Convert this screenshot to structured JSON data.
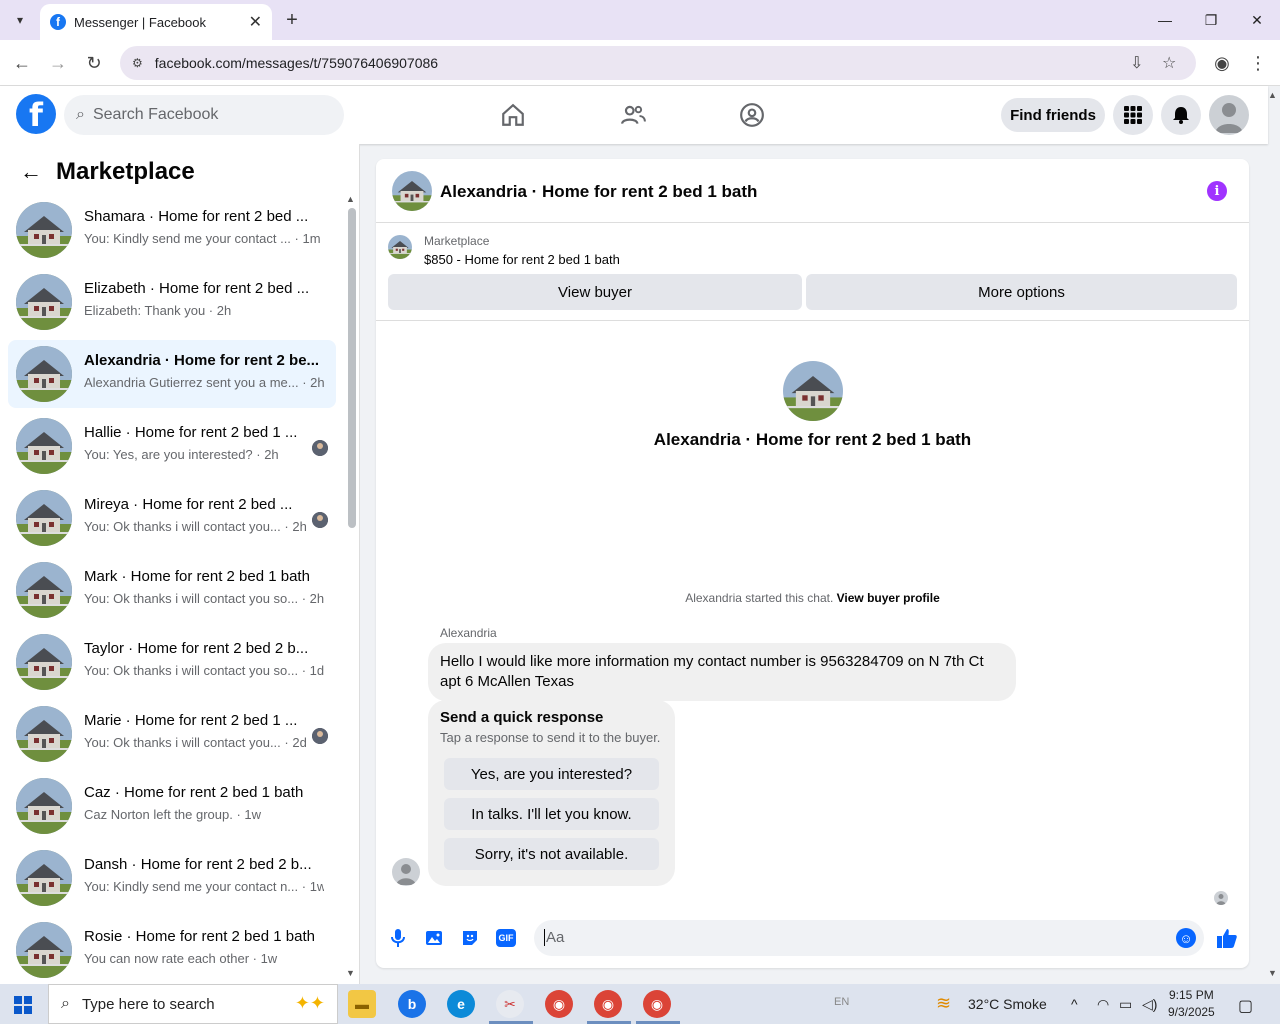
{
  "browser": {
    "tab_title": "Messenger | Facebook",
    "url": "facebook.com/messages/t/759076406907086"
  },
  "header": {
    "search_placeholder": "Search Facebook",
    "find_friends": "Find friends"
  },
  "sidebar": {
    "title": "Marketplace",
    "conversations": [
      {
        "name": "Shamara · Home for rent 2 bed ...",
        "snippet": "You: Kindly send me your contact ... · 1m",
        "mini": false
      },
      {
        "name": "Elizabeth · Home for rent 2 bed ...",
        "snippet": "Elizabeth: Thank you · 2h",
        "mini": false
      },
      {
        "name": "Alexandria · Home for rent 2 be...",
        "snippet": "Alexandria Gutierrez sent you a me... · 2h",
        "mini": false
      },
      {
        "name": "Hallie · Home for rent 2 bed 1 ...",
        "snippet": "You: Yes, are you interested? · 2h",
        "mini": true
      },
      {
        "name": "Mireya · Home for rent 2 bed ...",
        "snippet": "You: Ok thanks i will contact you... · 2h",
        "mini": true
      },
      {
        "name": "Mark · Home for rent 2 bed 1 bath",
        "snippet": "You: Ok thanks i will contact you so... · 2h",
        "mini": false
      },
      {
        "name": "Taylor · Home for rent 2 bed 2 b...",
        "snippet": "You: Ok thanks i will contact you so... · 1d",
        "mini": false
      },
      {
        "name": "Marie · Home for rent 2 bed 1 ...",
        "snippet": "You: Ok thanks i will contact you... · 2d",
        "mini": true
      },
      {
        "name": "Caz · Home for rent 2 bed 1 bath",
        "snippet": "Caz Norton left the group. · 1w",
        "mini": false
      },
      {
        "name": "Dansh · Home for rent 2 bed 2 b...",
        "snippet": "You: Kindly send me your contact n... · 1w",
        "mini": false
      },
      {
        "name": "Rosie · Home for rent 2 bed 1 bath",
        "snippet": "You can now rate each other · 1w",
        "mini": false
      }
    ]
  },
  "chat": {
    "title": "Alexandria · Home for rent 2 bed 1 bath",
    "marketplace_label": "Marketplace",
    "listing": "$850 - Home for rent 2 bed 1 bath",
    "view_buyer": "View buyer",
    "more_options": "More options",
    "center_name": "Alexandria · Home for rent 2 bed 1 bath",
    "started_text": "Alexandria started this chat.",
    "view_buyer_profile": "View buyer profile",
    "sender": "Alexandria",
    "message": "Hello I would like more information my contact number is 9563284709 on N 7th Ct apt 6 McAllen Texas",
    "quick_title": "Send a quick response",
    "quick_sub": "Tap a response to send it to the buyer.",
    "quick_options": [
      "Yes, are you interested?",
      "In talks. I'll let you know.",
      "Sorry, it's not available."
    ],
    "composer_placeholder": "Aa"
  },
  "taskbar": {
    "search_placeholder": "Type here to search",
    "lang": "EN",
    "weather": "32°C  Smoke",
    "time": "9:15 PM",
    "date": "9/3/2025"
  },
  "colors": {
    "facebook_blue": "#1877f2",
    "messenger_blue": "#0866ff",
    "info_purple": "#a033ff"
  }
}
